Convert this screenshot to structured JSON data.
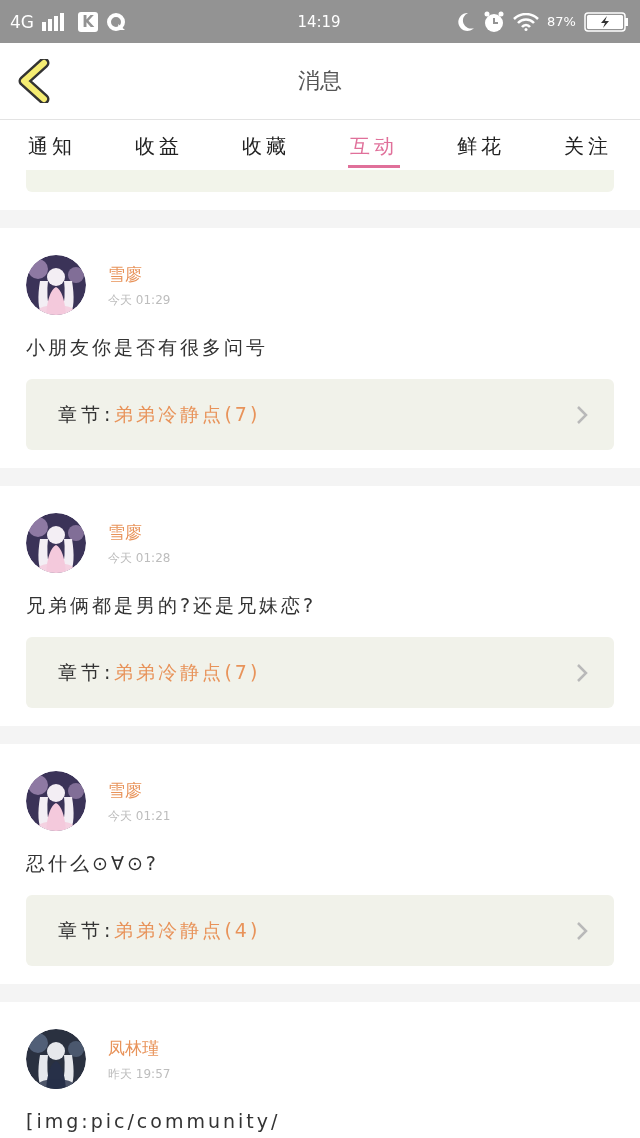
{
  "status_bar": {
    "network": "4G",
    "app_badge": "K",
    "time": "14:19",
    "battery": "87%"
  },
  "header": {
    "title": "消息"
  },
  "tabs": [
    {
      "label": "通知",
      "selected": false
    },
    {
      "label": "收益",
      "selected": false
    },
    {
      "label": "收藏",
      "selected": false
    },
    {
      "label": "互动",
      "selected": true
    },
    {
      "label": "鲜花",
      "selected": false
    },
    {
      "label": "关注",
      "selected": false
    }
  ],
  "messages": [
    {
      "user": "雪廖",
      "time": "今天 01:29",
      "text": "小朋友你是否有很多问号",
      "chapter_label": "章节:",
      "chapter": "弟弟冷静点(7)"
    },
    {
      "user": "雪廖",
      "time": "今天 01:28",
      "text": "兄弟俩都是男的?还是兄妹恋?",
      "chapter_label": "章节:",
      "chapter": "弟弟冷静点(7)"
    },
    {
      "user": "雪廖",
      "time": "今天 01:21",
      "text": "忍什么⊙∀⊙?",
      "chapter_label": "章节:",
      "chapter": "弟弟冷静点(4)"
    },
    {
      "user": "凤林瑾",
      "time": "昨天 19:57",
      "text": "[img:pic/community/"
    }
  ]
}
